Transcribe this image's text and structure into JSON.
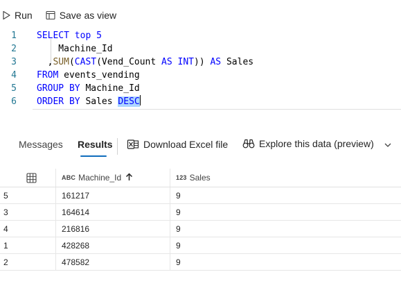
{
  "toolbar": {
    "run_label": "Run",
    "save_view_label": "Save as view"
  },
  "editor": {
    "lines": [
      {
        "num": "1",
        "tokens": [
          {
            "t": "SELECT top 5",
            "c": "kw"
          }
        ]
      },
      {
        "num": "2",
        "tokens": [
          {
            "t": "    Machine_Id",
            "c": "plain"
          }
        ]
      },
      {
        "num": "3",
        "tokens": [
          {
            "t": "  ,",
            "c": "plain"
          },
          {
            "t": "SUM",
            "c": "fn"
          },
          {
            "t": "(",
            "c": "plain"
          },
          {
            "t": "CAST",
            "c": "kw"
          },
          {
            "t": "(Vend_Count ",
            "c": "plain"
          },
          {
            "t": "AS INT",
            "c": "kw"
          },
          {
            "t": ")) ",
            "c": "plain"
          },
          {
            "t": "AS",
            "c": "kw"
          },
          {
            "t": " Sales",
            "c": "plain"
          }
        ]
      },
      {
        "num": "4",
        "tokens": [
          {
            "t": "FROM",
            "c": "kw"
          },
          {
            "t": " events_vending",
            "c": "plain"
          }
        ]
      },
      {
        "num": "5",
        "tokens": [
          {
            "t": "GROUP BY",
            "c": "kw"
          },
          {
            "t": " Machine_Id",
            "c": "plain"
          }
        ]
      },
      {
        "num": "6",
        "tokens": [
          {
            "t": "ORDER BY",
            "c": "kw"
          },
          {
            "t": " Sales ",
            "c": "plain"
          },
          {
            "t": "DESC",
            "c": "kw",
            "sel": true
          }
        ]
      }
    ]
  },
  "tabs": {
    "messages": "Messages",
    "results": "Results",
    "download": "Download Excel file",
    "explore": "Explore this data (preview)"
  },
  "grid": {
    "columns": [
      {
        "type": "ABC",
        "name": "Machine_Id",
        "sorted": "asc"
      },
      {
        "type": "123",
        "name": "Sales"
      }
    ],
    "rows": [
      {
        "idx": "5",
        "machine_id": "161217",
        "sales": "9"
      },
      {
        "idx": "3",
        "machine_id": "164614",
        "sales": "9"
      },
      {
        "idx": "4",
        "machine_id": "216816",
        "sales": "9"
      },
      {
        "idx": "1",
        "machine_id": "428268",
        "sales": "9"
      },
      {
        "idx": "2",
        "machine_id": "478582",
        "sales": "9"
      }
    ]
  },
  "colors": {
    "keyword": "#0000ff",
    "function": "#795e26",
    "line_number": "#237893",
    "accent": "#0f6cbd",
    "selection": "#add6ff"
  },
  "icons": [
    "play-icon",
    "save-view-icon",
    "excel-icon",
    "binoculars-icon",
    "chevron-down-icon",
    "table-grid-icon",
    "sort-up-arrow-icon"
  ]
}
